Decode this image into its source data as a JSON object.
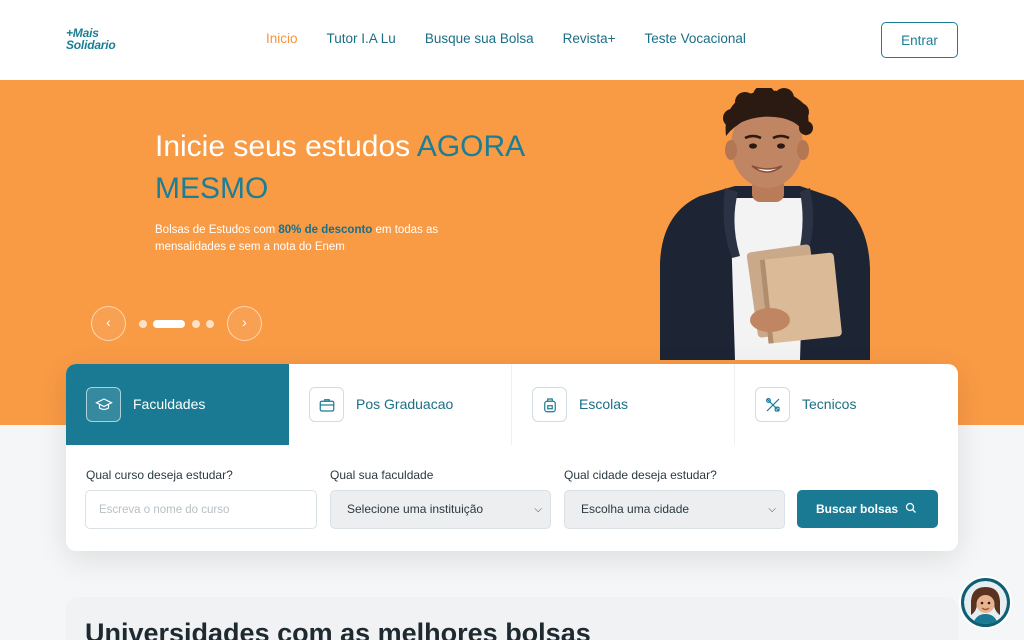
{
  "header": {
    "logo_line1": "+Mais",
    "logo_line2": "Solidario",
    "nav": [
      {
        "label": "Inicio",
        "active": true
      },
      {
        "label": "Tutor I.A Lu"
      },
      {
        "label": "Busque sua Bolsa"
      },
      {
        "label": "Revista+"
      },
      {
        "label": "Teste Vocacional"
      }
    ],
    "login_label": "Entrar"
  },
  "hero": {
    "title_part1": "Inicie seus estudos ",
    "title_accent": "AGORA MESMO",
    "subtitle_part1": "Bolsas de Estudos com ",
    "subtitle_highlight": "80% de desconto",
    "subtitle_part2": " em todas as mensalidades e sem a nota do Enem",
    "prev_icon": "‹",
    "next_icon": "›",
    "slides_total": 4,
    "slide_active": 2
  },
  "search": {
    "tabs": [
      {
        "label": "Faculdades",
        "icon": "graduation-cap-icon",
        "active": true
      },
      {
        "label": "Pos Graduacao",
        "icon": "briefcase-icon"
      },
      {
        "label": "Escolas",
        "icon": "backpack-icon"
      },
      {
        "label": "Tecnicos",
        "icon": "tools-icon"
      }
    ],
    "course_label": "Qual curso deseja estudar?",
    "course_placeholder": "Escreva o nome do curso",
    "college_label": "Qual sua faculdade",
    "college_value": "Selecione uma instituição",
    "city_label": "Qual cidade deseja estudar?",
    "city_value": "Escolha uma cidade",
    "button_label": "Buscar bolsas"
  },
  "section": {
    "title": "Universidades com as melhores bolsas"
  },
  "colors": {
    "brand": "#1a7a93",
    "accent": "#f5953d",
    "hero_bg": "#f99a45"
  }
}
